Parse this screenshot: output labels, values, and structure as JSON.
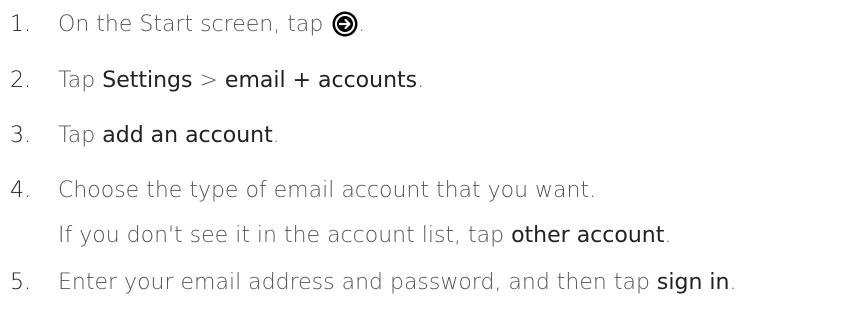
{
  "steps": [
    {
      "number": "1.",
      "text_before": "On the Start screen, tap ",
      "icon": "arrow-right-circle-icon",
      "text_after": "."
    },
    {
      "number": "2.",
      "prefix": "Tap ",
      "ui1": "Settings",
      "sep": " > ",
      "ui2": "email + accounts",
      "suffix": "."
    },
    {
      "number": "3.",
      "prefix": "Tap ",
      "ui": "add an account",
      "suffix": "."
    },
    {
      "number": "4.",
      "text": "Choose the type of email account that you want.",
      "sub_prefix": "If you don't see it in the account list, tap ",
      "sub_ui": "other account",
      "sub_suffix": "."
    },
    {
      "number": "5.",
      "prefix": "Enter your email address and password, and then tap ",
      "ui": "sign in",
      "suffix": "."
    }
  ],
  "colors": {
    "body_text": "#555555",
    "ui_text": "#222222",
    "icon_fill": "#000000"
  }
}
